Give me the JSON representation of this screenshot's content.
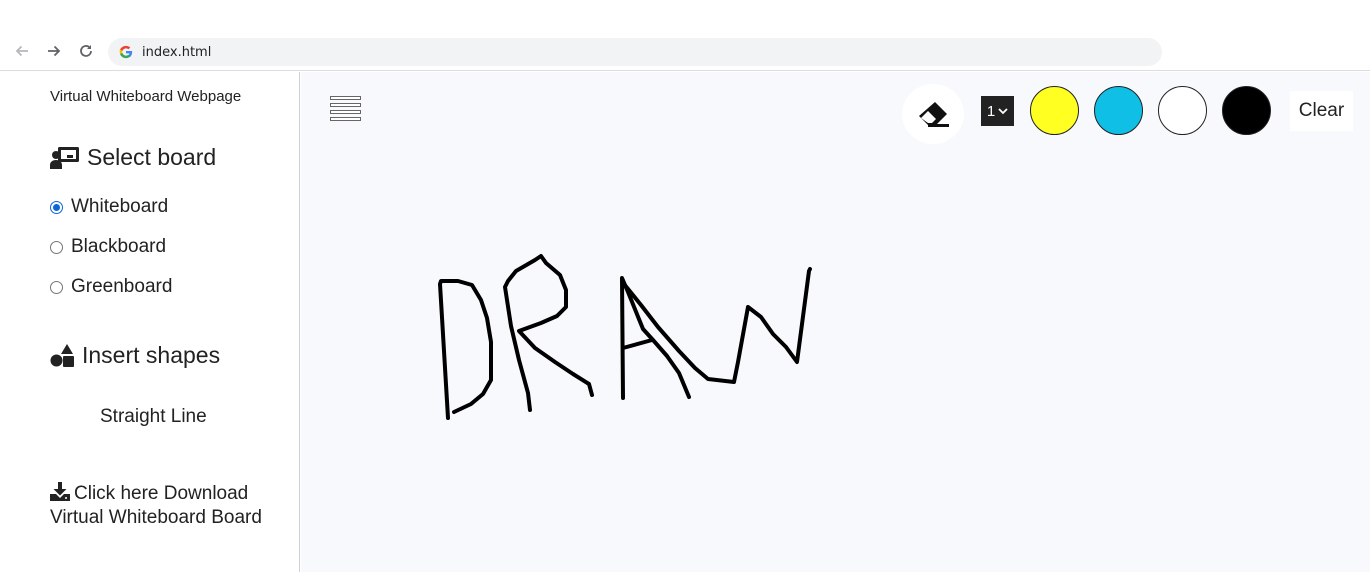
{
  "browser": {
    "url": "index.html",
    "icons": [
      "back-arrow-icon",
      "forward-arrow-icon",
      "reload-icon",
      "google-icon"
    ]
  },
  "sidebar": {
    "title": "Virtual Whiteboard Webpage",
    "select_board": {
      "heading": "Select board",
      "icon": "presentation-user-icon",
      "options": [
        {
          "label": "Whiteboard",
          "checked": true
        },
        {
          "label": "Blackboard",
          "checked": false
        },
        {
          "label": "Greenboard",
          "checked": false
        }
      ]
    },
    "insert_shapes": {
      "heading": "Insert shapes",
      "icon": "shapes-icon",
      "straight_line": "Straight Line"
    },
    "download": {
      "icon": "download-icon",
      "label": "Click here Download Virtual Whiteboard Board"
    }
  },
  "toolbar": {
    "menu_icon": "hamburger-menu-icon",
    "eraser_icon": "eraser-icon",
    "brush_size": "1",
    "colors": [
      "#ffff22",
      "#0fbfe6",
      "#ffffff",
      "#000000"
    ],
    "clear_label": "Clear"
  },
  "canvas": {
    "background": "#f8f9fd",
    "stroke_color": "#000000"
  }
}
